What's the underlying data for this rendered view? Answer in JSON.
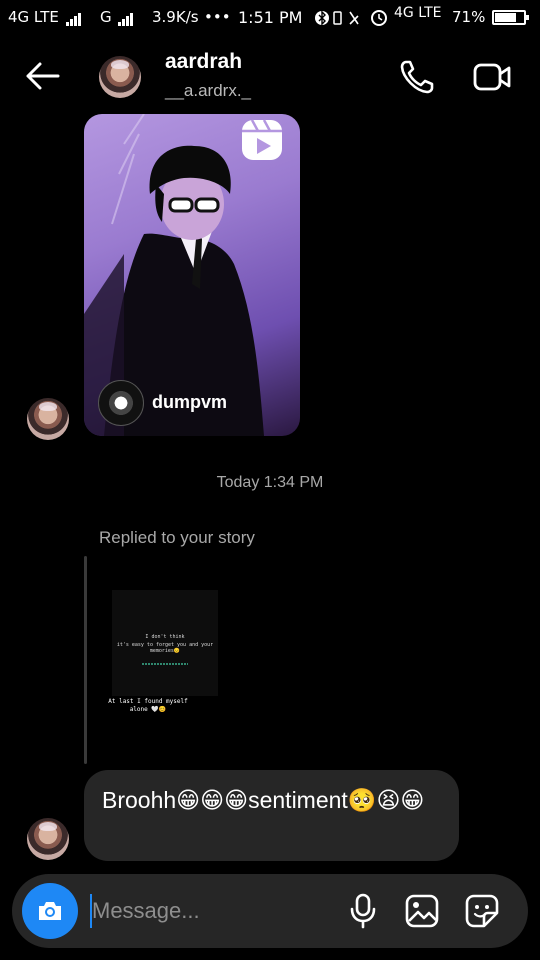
{
  "status_bar": {
    "network_1": "4G LTE",
    "network_2": "G",
    "speed": "3.9K/s",
    "dots": "•••",
    "time": "1:51 PM",
    "network_3": "4G LTE",
    "battery_percent": "71%",
    "battery_level": 0.71
  },
  "header": {
    "name": "aardrah",
    "username": "__a.ardrx._"
  },
  "reel": {
    "owner": "dumpvm"
  },
  "timestamp": "Today 1:34 PM",
  "reply": {
    "label": "Replied to your story",
    "story_line_1": "I don't think",
    "story_line_2": "it's easy to forget you and your memories😔",
    "story_caption": "At last I found myself alone 🤍😊"
  },
  "message": {
    "text": "Broohh😁😁😁sentiment🥺😫😁"
  },
  "composer": {
    "placeholder": "Message..."
  },
  "colors": {
    "accent": "#1e88f5",
    "bubble": "#262626",
    "secondary_text": "#a8a8a8"
  },
  "icons": [
    "back-arrow-icon",
    "phone-icon",
    "video-call-icon",
    "reels-icon",
    "camera-icon",
    "microphone-icon",
    "gallery-icon",
    "sticker-icon"
  ]
}
